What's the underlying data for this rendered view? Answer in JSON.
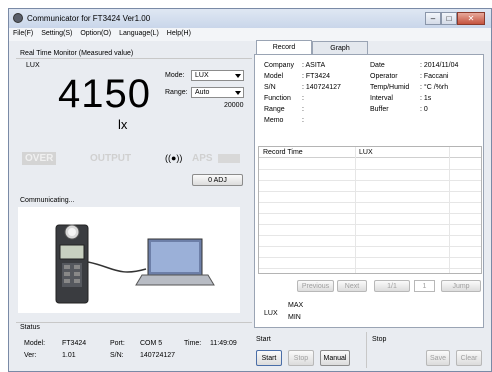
{
  "window": {
    "title": "Communicator for FT3424  Ver1.00"
  },
  "menu": [
    "File(F)",
    "Setting(S)",
    "Option(O)",
    "Language(L)",
    "Help(H)"
  ],
  "monitor": {
    "group_title": "Real Time Monitor (Measured value)",
    "unit_label": "LUX",
    "value": "4150",
    "unit": "lx",
    "mode_label": "Mode:",
    "mode_value": "LUX",
    "range_label": "Range:",
    "range_value": "Auto",
    "range_max": "20000",
    "over": "OVER",
    "output": "OUTPUT",
    "aps": "APS",
    "zero_adj": "0 ADJ"
  },
  "communicating": {
    "title": "Communicating..."
  },
  "status": {
    "title": "Status",
    "model_label": "Model:",
    "model": "FT3424",
    "port_label": "Port:",
    "port": "COM 5",
    "time_label": "Time:",
    "time": "11:49:09",
    "ver_label": "Ver:",
    "ver": "1.01",
    "sn_label": "S/N:",
    "sn": "140724127"
  },
  "tabs": {
    "record": "Record",
    "graph": "Graph"
  },
  "info": {
    "company_label": "Company",
    "company": ": ASITA",
    "model_label": "Model",
    "model": ": FT3424",
    "sn_label": "S/N",
    "sn": ": 140724127",
    "function_label": "Function",
    "function": ":",
    "range_label": "Range",
    "range": ":",
    "memo_label": "Memo",
    "memo": ":",
    "date_label": "Date",
    "date": ": 2014/11/04",
    "operator_label": "Operator",
    "operator": ": Faccani",
    "temp_label": "Temp/Humid",
    "temp": ": °C /%rh",
    "interval_label": "Interval",
    "interval": ": 1s",
    "buffer_label": "Buffer",
    "buffer": ": 0"
  },
  "table": {
    "col1": "Record Time",
    "col2": "LUX"
  },
  "pager": {
    "previous": "Previous",
    "next": "Next",
    "page": "1/1",
    "page_input": "1",
    "jump": "Jump"
  },
  "summary": {
    "lux": "LUX",
    "max": "MAX",
    "min": "MIN"
  },
  "controls": {
    "start_label": "Start",
    "stop_label": "Stop",
    "start_btn": "Start",
    "stop_btn": "Stop",
    "manual_btn": "Manual",
    "save_btn": "Save",
    "clear_btn": "Clear"
  }
}
